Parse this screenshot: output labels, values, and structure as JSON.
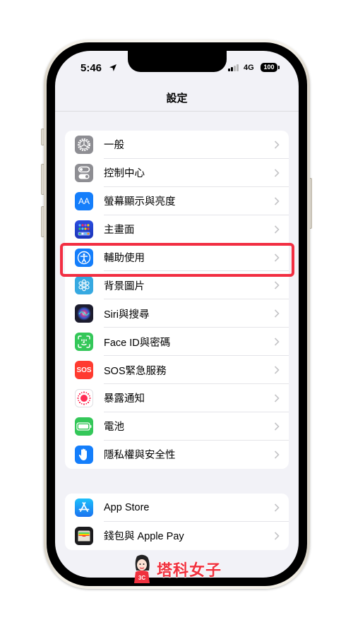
{
  "status_bar": {
    "time": "5:46",
    "network": "4G",
    "battery": "100",
    "location_icon": "location-arrow-icon",
    "signal_icon": "cellular-signal-icon"
  },
  "nav": {
    "title": "設定"
  },
  "groups": [
    {
      "items": [
        {
          "label": "一般",
          "icon": "gear-icon",
          "color": "#8e8e93"
        },
        {
          "label": "控制中心",
          "icon": "toggles-icon",
          "color": "#8e8e93"
        },
        {
          "label": "螢幕顯示與亮度",
          "icon": "text-size-icon",
          "color": "#147efb",
          "glyph": "AA"
        },
        {
          "label": "主畫面",
          "icon": "home-screen-icon",
          "color": "#2343d1"
        },
        {
          "label": "輔助使用",
          "icon": "accessibility-icon",
          "color": "#147efb",
          "highlighted": true
        },
        {
          "label": "背景圖片",
          "icon": "wallpaper-flower-icon",
          "color": "#36a9e1"
        },
        {
          "label": "Siri與搜尋",
          "icon": "siri-icon",
          "color": "#1c1c2e"
        },
        {
          "label": "Face ID與密碼",
          "icon": "face-id-icon",
          "color": "#34c759"
        },
        {
          "label": "SOS緊急服務",
          "icon": "sos-icon",
          "color": "#ff3b30",
          "glyph": "SOS"
        },
        {
          "label": "暴露通知",
          "icon": "exposure-notification-icon",
          "color": "#ffffff"
        },
        {
          "label": "電池",
          "icon": "battery-icon",
          "color": "#34c759"
        },
        {
          "label": "隱私權與安全性",
          "icon": "hand-privacy-icon",
          "color": "#147efb"
        }
      ]
    },
    {
      "items": [
        {
          "label": "App Store",
          "icon": "app-store-icon",
          "color": "#1a8cf8"
        },
        {
          "label": "錢包與 Apple Pay",
          "icon": "wallet-icon",
          "color": "#1c1c1e"
        }
      ]
    }
  ],
  "highlight_color": "#f22e42",
  "watermark": {
    "text": "塔科女子",
    "badge": "3C"
  }
}
